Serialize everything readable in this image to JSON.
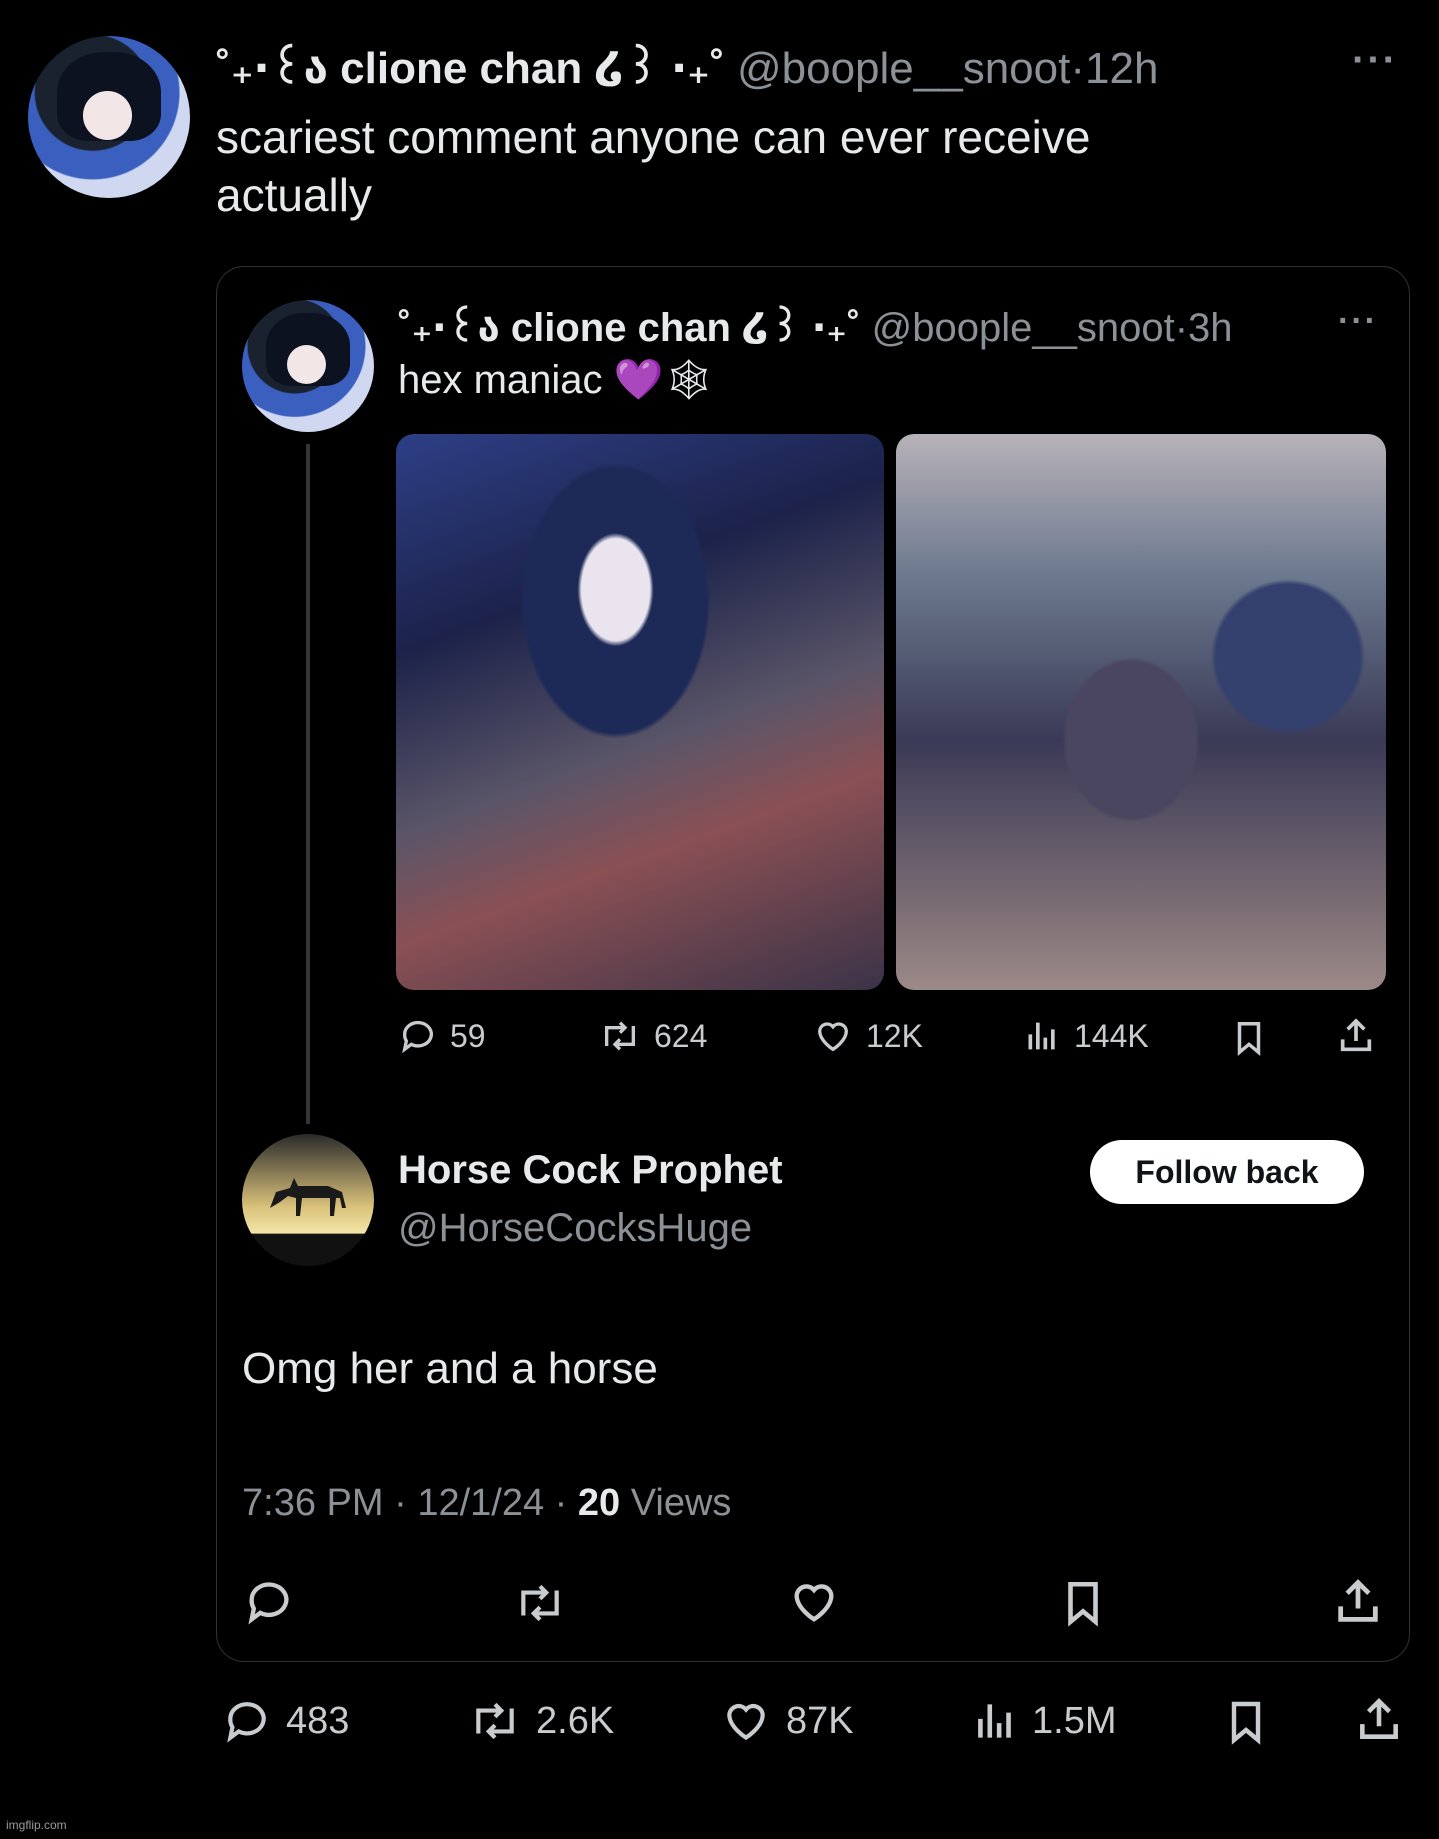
{
  "outer_tweet": {
    "display_name": "˚₊‧꒰ა clione chan ໒꒱ ‧₊˚",
    "handle": "@boople__snoot",
    "separator": "·",
    "time": "12h",
    "text_line1": "scariest comment anyone can ever receive",
    "text_line2": "actually",
    "actions": {
      "replies": "483",
      "reposts": "2.6K",
      "likes": "87K",
      "views": "1.5M"
    }
  },
  "quoted_tweet": {
    "display_name": "˚₊‧꒰ა clione chan ໒꒱ ‧₊˚",
    "handle": "@boople__snoot",
    "separator": "·",
    "time": "3h",
    "text": "hex maniac 💜🕸",
    "actions": {
      "replies": "59",
      "reposts": "624",
      "likes": "12K",
      "views": "144K"
    }
  },
  "reply": {
    "display_name": "Horse Cock Prophet",
    "handle": "@HorseCocksHuge",
    "follow_button": "Follow back",
    "text": "Omg her and a horse",
    "time": "7:36 PM",
    "date": "12/1/24",
    "views_count": "20",
    "views_label": "Views",
    "sep": "·"
  },
  "watermark": "imgflip.com",
  "colors": {
    "background": "#000000",
    "text": "#e7e9ea",
    "muted": "#8b9197",
    "border": "#2f3336"
  }
}
